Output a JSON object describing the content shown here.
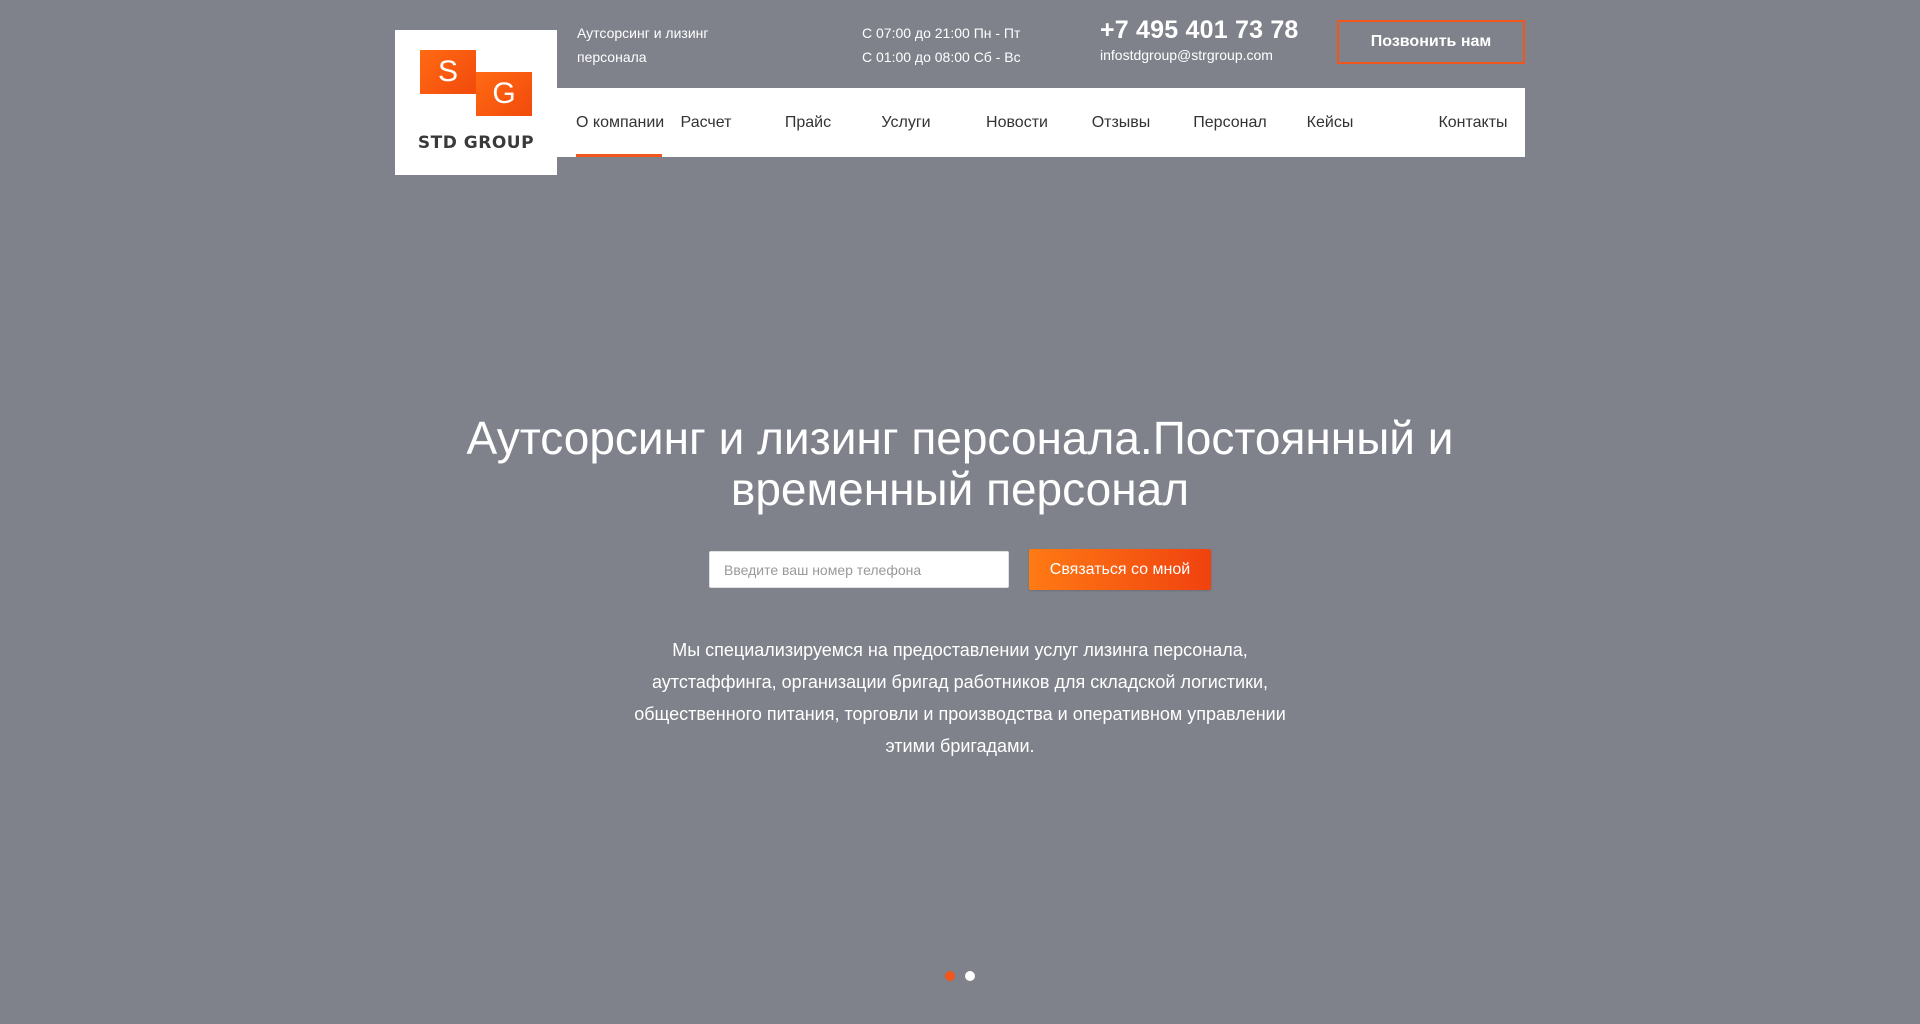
{
  "brand": {
    "logo_text": "STD GROUP",
    "logo_letters": [
      "S",
      "G"
    ],
    "tagline": "Аутсорсинг и лизинг персонала"
  },
  "hours": {
    "weekdays": "С 07:00 до 21:00 Пн - Пт",
    "weekend": "С 01:00 до 08:00 Сб - Вс"
  },
  "contacts": {
    "phone": "+7 495 401 73 78",
    "email": "infostdgroup@strgroup.com",
    "call_button": "Позвонить нам"
  },
  "nav": {
    "items": [
      {
        "label": "О компании",
        "active": true
      },
      {
        "label": "Расчет"
      },
      {
        "label": "Прайс"
      },
      {
        "label": "Услуги"
      },
      {
        "label": "Новости"
      },
      {
        "label": "Отзывы"
      },
      {
        "label": "Персонал"
      },
      {
        "label": "Кейсы"
      },
      {
        "label": "Контакты"
      }
    ]
  },
  "hero": {
    "title": "Аутсорсинг и лизинг персонала.Постоянный и временный персонал",
    "phone_placeholder": "Введите ваш номер телефона",
    "contact_button": "Связаться со мной",
    "description": "Мы специализируемся на предоставлении услуг лизинга персонала, аутстаффинга, организации бригад работников для складской логистики, общественного питания, торговли и производства и оперативном управлении этими бригадами."
  },
  "slider": {
    "count": 2,
    "current": 1
  },
  "colors": {
    "background": "#7f828b",
    "accent": "#f2561d",
    "nav_bg": "#ffffff"
  }
}
